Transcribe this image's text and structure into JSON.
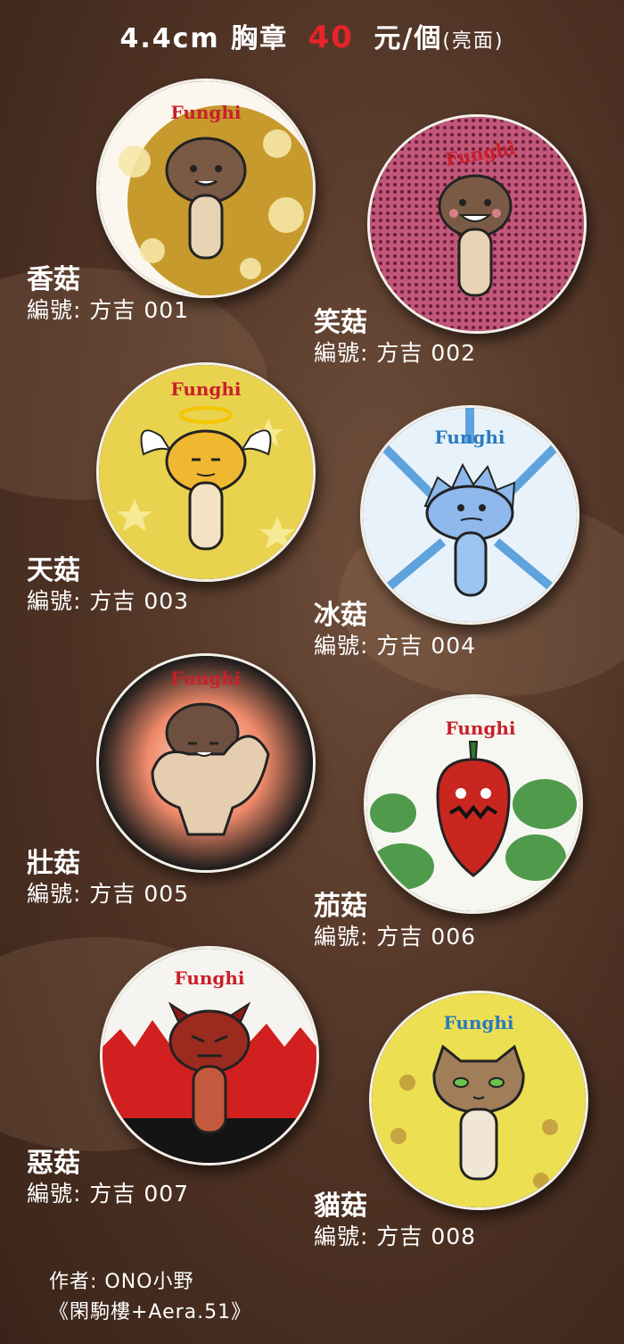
{
  "header": {
    "size": "4.4cm",
    "item": "胸章",
    "price": "40",
    "unit_text": "元/個",
    "finish": "(亮面)"
  },
  "badges": [
    {
      "name": "香菇",
      "code": "編號: 方吉 001",
      "logo": "Funghi"
    },
    {
      "name": "笑菇",
      "code": "編號: 方吉 002",
      "logo": "Funghi"
    },
    {
      "name": "天菇",
      "code": "編號: 方吉 003",
      "logo": "Funghi"
    },
    {
      "name": "冰菇",
      "code": "編號: 方吉 004",
      "logo": "Funghi"
    },
    {
      "name": "壯菇",
      "code": "編號: 方吉 005",
      "logo": "Funghi"
    },
    {
      "name": "茄菇",
      "code": "編號: 方吉 006",
      "logo": "Funghi"
    },
    {
      "name": "惡菇",
      "code": "編號: 方吉 007",
      "logo": "Funghi"
    },
    {
      "name": "貓菇",
      "code": "編號: 方吉 008",
      "logo": "Funghi"
    }
  ],
  "credit": {
    "line1": "作者: ONO小野",
    "line2": "《閑駒樓+Aera.51》"
  },
  "colors": {
    "price": "#e8232a",
    "background": "#4e3224"
  }
}
